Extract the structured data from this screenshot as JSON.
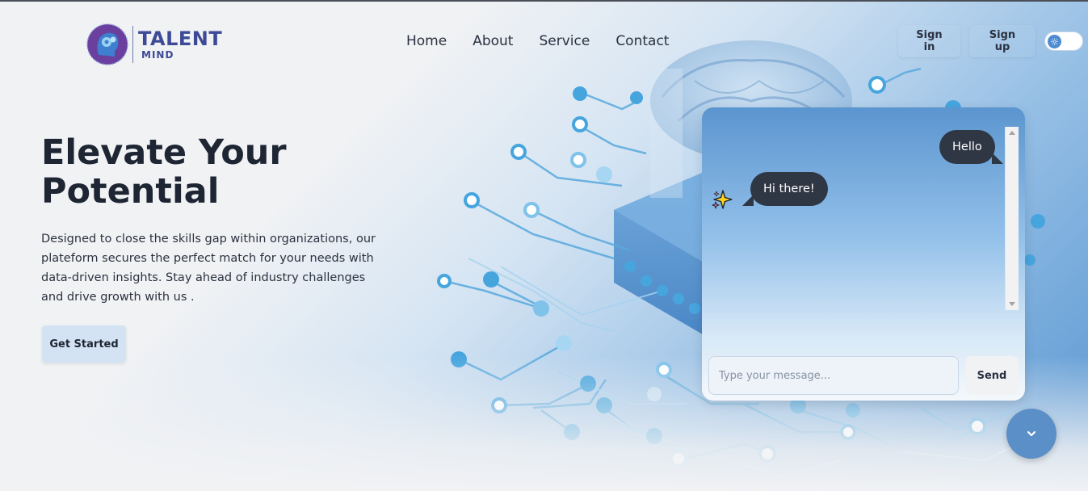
{
  "brand": {
    "name": "TALENT",
    "subname": "MIND"
  },
  "nav": {
    "items": [
      {
        "label": "Home"
      },
      {
        "label": "About"
      },
      {
        "label": "Service"
      },
      {
        "label": "Contact"
      }
    ]
  },
  "auth": {
    "sign_in_label": "Sign in",
    "sign_up_label": "Sign up"
  },
  "theme_toggle": {
    "icon": "sun-icon"
  },
  "hero": {
    "title": "Elevate Your Potential",
    "description": "Designed to close the skills gap within organizations, our plateform secures the perfect match for your needs with data-driven insights. Stay ahead of industry challenges and drive growth with us .",
    "cta_label": "Get Started"
  },
  "chat": {
    "messages": [
      {
        "sender": "user",
        "text": "Hello"
      },
      {
        "sender": "bot",
        "text": "Hi there!"
      }
    ],
    "input_placeholder": "Type your message...",
    "input_value": "",
    "send_label": "Send",
    "bot_icon": "sparkles-icon"
  },
  "colors": {
    "brand": "#3d4a96",
    "accent": "#5b8fc7",
    "bubble": "#2f3744"
  }
}
